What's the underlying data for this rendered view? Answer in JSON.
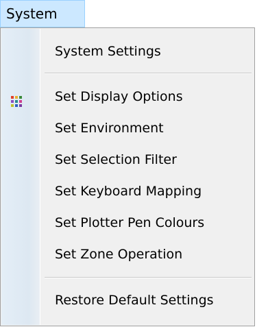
{
  "menubar": {
    "active_menu": "System"
  },
  "dropdown": {
    "items": [
      {
        "label": "System Settings"
      },
      {
        "label": "Set Display Options",
        "icon": "grid-colors-icon"
      },
      {
        "label": "Set Environment"
      },
      {
        "label": "Set Selection Filter"
      },
      {
        "label": "Set Keyboard Mapping"
      },
      {
        "label": "Set Plotter Pen Colours"
      },
      {
        "label": "Set Zone Operation"
      },
      {
        "label": "Restore Default Settings"
      }
    ]
  },
  "colors": {
    "menu_highlight": "#cce8ff",
    "menu_background": "#f0f0f0",
    "separator": "#c8c8c8"
  }
}
